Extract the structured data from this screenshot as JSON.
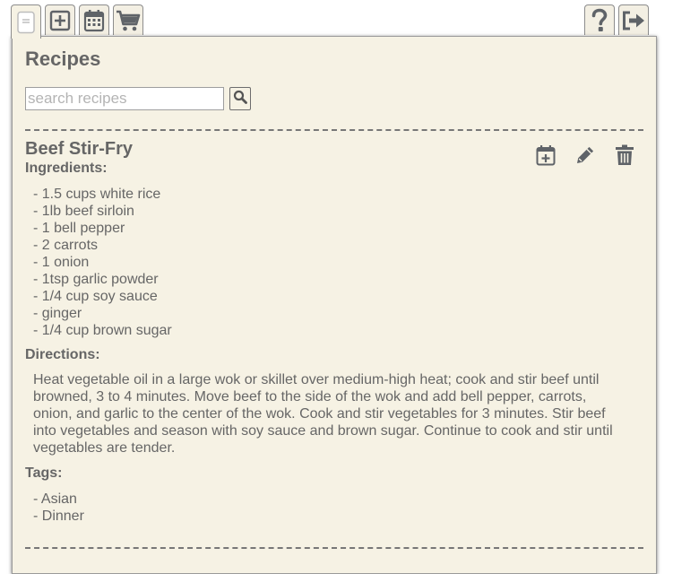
{
  "toolbar": {
    "left": [
      {
        "name": "recipes-icon",
        "active": true
      },
      {
        "name": "add-recipe-icon",
        "active": false
      },
      {
        "name": "calendar-icon",
        "active": false
      },
      {
        "name": "shopping-cart-icon",
        "active": false
      }
    ],
    "right": [
      {
        "name": "help-icon"
      },
      {
        "name": "logout-icon"
      }
    ]
  },
  "panel": {
    "title": "Recipes",
    "search": {
      "placeholder": "search recipes",
      "value": ""
    }
  },
  "recipe": {
    "title": "Beef Stir-Fry",
    "ingredients_label": "Ingredients:",
    "ingredients": [
      "- 1.5 cups white rice",
      "- 1lb beef sirloin",
      "- 1 bell pepper",
      "- 2 carrots",
      "- 1 onion",
      "- 1tsp garlic powder",
      "- 1/4 cup soy sauce",
      "- ginger",
      "- 1/4 cup brown sugar"
    ],
    "directions_label": "Directions:",
    "directions": "Heat vegetable oil in a large wok or skillet over medium-high heat; cook and stir beef until browned, 3 to 4 minutes. Move beef to the side of the wok and add bell pepper, carrots, onion, and garlic to the center of the wok. Cook and stir vegetables for 3 minutes. Stir beef into vegetables and season with soy sauce and brown sugar. Continue to cook and stir until vegetables are tender.",
    "tags_label": "Tags:",
    "tags": [
      "- Asian",
      "- Dinner"
    ],
    "actions": [
      "calendar-add-icon",
      "edit-pencil-icon",
      "trash-icon"
    ]
  },
  "colors": {
    "panel_bg": "#f6f2e4",
    "text": "#666666",
    "icon": "#5f6368"
  }
}
